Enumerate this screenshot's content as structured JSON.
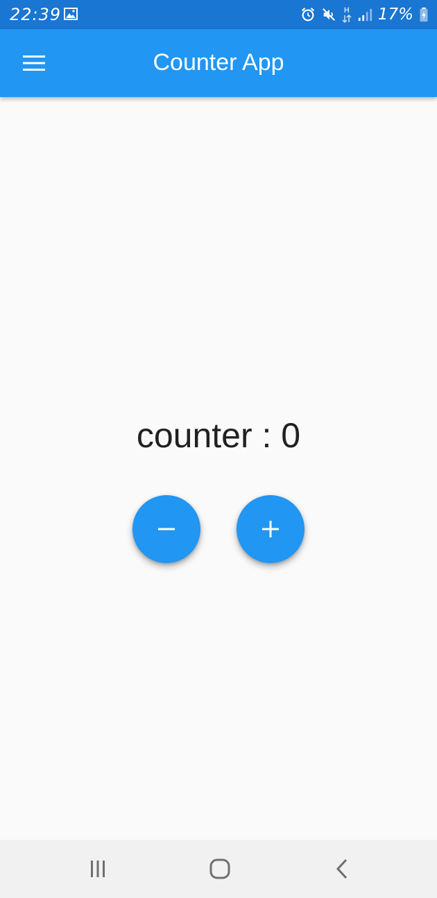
{
  "status_bar": {
    "time": "22:39",
    "battery": "17%",
    "network": "H",
    "icons": [
      "gallery-icon",
      "alarm-icon",
      "mute-icon",
      "data-arrows-icon",
      "signal-icon",
      "battery-charging-icon"
    ]
  },
  "app_bar": {
    "title": "Counter App",
    "menu_icon": "menu-icon"
  },
  "main": {
    "counter_text": "counter : 0",
    "decrement_icon": "minus-icon",
    "increment_icon": "plus-icon"
  },
  "nav_bar": {
    "icons": [
      "recent-apps-icon",
      "home-icon",
      "back-icon"
    ]
  },
  "colors": {
    "status_bar": "#1976d2",
    "primary": "#2196f3",
    "background": "#fafafa",
    "nav_bar": "#f1f1f1",
    "text": "#212121"
  }
}
